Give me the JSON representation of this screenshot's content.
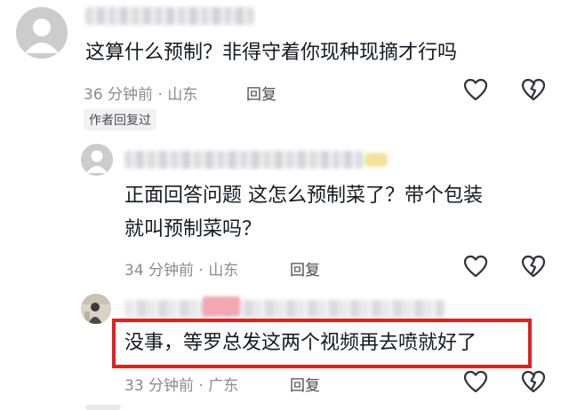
{
  "comments": [
    {
      "text": "这算什么预制？非得守着你现种现摘才行吗",
      "time": "36 分钟前 · 山东",
      "reply_label": "回复",
      "author_tag": "作者回复过"
    },
    {
      "lines": [
        "正面回答问题 这怎么预制菜了？带个包装",
        "就叫预制菜吗？"
      ],
      "time": "34 分钟前 · 山东",
      "reply_label": "回复"
    },
    {
      "text": "没事，等罗总发这两个视频再去喷就好了",
      "time": "33 分钟前 · 广东",
      "reply_label": "回复"
    }
  ],
  "colors": {
    "highlight": "#e0211b",
    "meta": "#8a8b91",
    "text": "#161823"
  },
  "icons": [
    "default-avatar-icon",
    "heart-icon",
    "broken-heart-icon"
  ]
}
